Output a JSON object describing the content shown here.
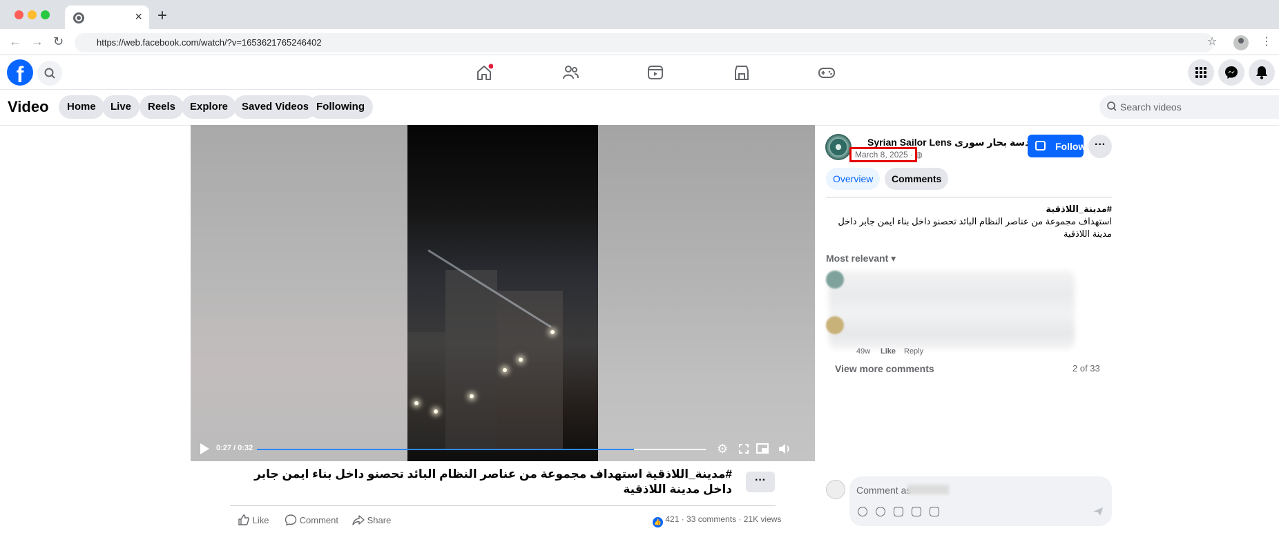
{
  "browser": {
    "tab_close": "×",
    "new_tab": "+",
    "url": "https://web.facebook.com/watch/?v=1653621765246402",
    "back": "←",
    "forward": "→",
    "reload": "↻",
    "star": "☆",
    "menu": "⋮"
  },
  "fb": {
    "logo": "f",
    "nav_icons": [
      "home-icon",
      "friends-icon",
      "watch-icon",
      "marketplace-icon",
      "gaming-icon"
    ],
    "right_icons": [
      "menu-grid-icon",
      "messenger-icon",
      "notifications-icon"
    ]
  },
  "video_nav": {
    "title": "Video",
    "pills": [
      "Home",
      "Live",
      "Reels",
      "Explore",
      "Saved Videos",
      "Following"
    ],
    "search_placeholder": "Search videos"
  },
  "player": {
    "time": "0:27 / 0:32",
    "progress": 0.84
  },
  "post": {
    "caption": "#مدينة_اللاذقية استهداف مجموعة من عناصر النظام البائد تحصنو داخل بناء ايمن جابر داخل مدينة اللاذقية",
    "more": "···",
    "actions": {
      "like": "Like",
      "comment": "Comment",
      "share": "Share"
    },
    "reactions": "421",
    "stats_rest": " · 33 comments · 21K views"
  },
  "side": {
    "page_name": "Syrian Sailor Lens عدسة بحار سورى",
    "date": "March 8, 2025 · ◍",
    "follow": "Follow",
    "more": "···",
    "tab_overview": "Overview",
    "tab_comments": "Comments",
    "desc_hashtag": "#مدينة_اللاذقية",
    "desc_text": "استهداف مجموعة من عناصر النظام البائد تحصنو داخل بناء ايمن جابر داخل مدينة اللاذقية",
    "most_relevant": "Most relevant ▾",
    "comment_age": "49w",
    "comment_like": "Like",
    "comment_reply": "Reply",
    "view_more": "View more comments",
    "count": "2 of 33",
    "comment_placeholder": "Comment as"
  },
  "colors": {
    "fb_blue": "#0866ff",
    "highlight_red": "#e50000"
  }
}
